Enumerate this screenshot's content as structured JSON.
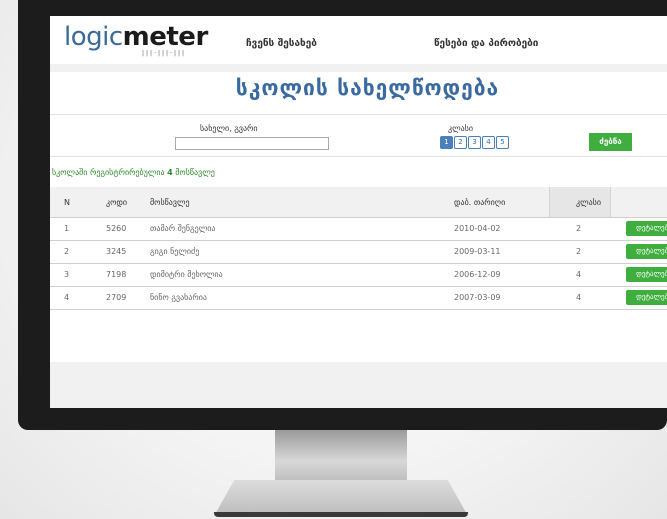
{
  "header": {
    "logo_text_a": "logic",
    "logo_text_b": "meter",
    "logo_sub": "|||·|||·|||",
    "nav": [
      "ჩვენს შესახებ",
      "წესები და პირობები"
    ]
  },
  "page_title": "სკოლის სახელწოდება",
  "search": {
    "name_label": "სახელი, გვარი",
    "name_value": "",
    "class_label": "კლასი",
    "class_options": [
      "1",
      "2",
      "3",
      "4",
      "5"
    ],
    "class_selected": "1",
    "search_button": "ძებნა"
  },
  "registered": {
    "prefix": "სკოლაში რეგისტრირებულია",
    "count": "4",
    "suffix": "მოსწავლე"
  },
  "table": {
    "columns": [
      "N",
      "კოდი",
      "მოსწავლე",
      "დაბ. თარიღი",
      "კლასი"
    ],
    "rows": [
      {
        "n": "1",
        "code": "5260",
        "student": "თამარ შენგელია",
        "dob": "2010-04-02",
        "class": "2",
        "action": "დეტალები"
      },
      {
        "n": "2",
        "code": "3245",
        "student": "გიგი ნელიძე",
        "dob": "2009-03-11",
        "class": "2",
        "action": "დეტალები"
      },
      {
        "n": "3",
        "code": "7198",
        "student": "დიმიტრი მეხოლია",
        "dob": "2006-12-09",
        "class": "4",
        "action": "დეტალები"
      },
      {
        "n": "4",
        "code": "2709",
        "student": "ნინო გვახარია",
        "dob": "2007-03-09",
        "class": "4",
        "action": "დეტალები"
      }
    ]
  },
  "colors": {
    "accent_blue": "#3a6aa0",
    "green": "#3fae3f"
  }
}
